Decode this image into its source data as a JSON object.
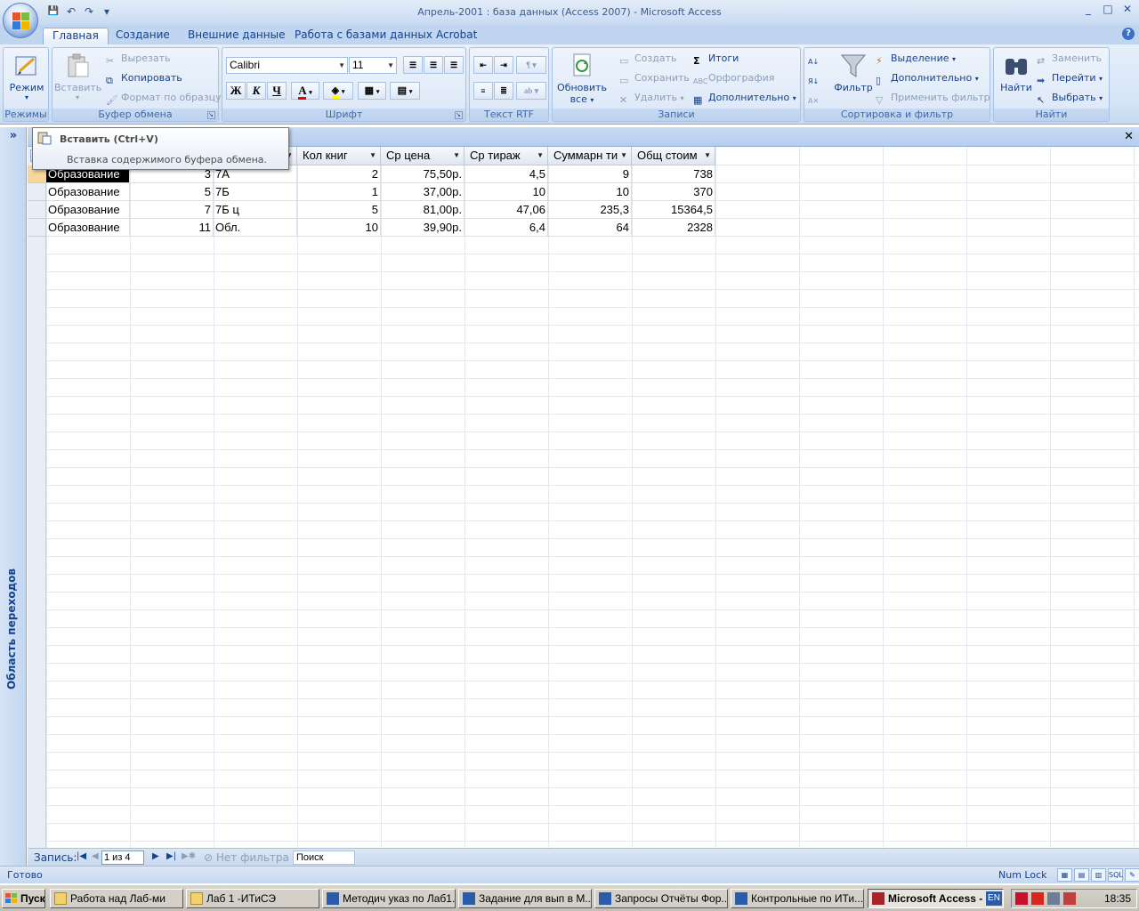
{
  "window": {
    "title": "Апрель-2001 : база данных (Access 2007) - Microsoft Access",
    "min": "_",
    "max": "□",
    "close": "✕"
  },
  "qat": {
    "save": "💾",
    "undo": "↶",
    "redo": "↷",
    "more": "▾"
  },
  "tabs": [
    "Главная",
    "Создание",
    "Внешние данные",
    "Работа с базами данных",
    "Acrobat"
  ],
  "help": "?",
  "ribbon": {
    "modes": {
      "view": "Режим",
      "group": "Режимы"
    },
    "clipboard": {
      "paste": "Вставить",
      "cut": "Вырезать",
      "copy": "Копировать",
      "format_painter": "Формат по образцу",
      "group": "Буфер обмена"
    },
    "font": {
      "name": "Calibri",
      "size": "11",
      "bold": "Ж",
      "italic": "К",
      "underline": "Ч",
      "group": "Шрифт"
    },
    "rtf": {
      "group": "Текст RTF"
    },
    "records": {
      "refresh": "Обновить",
      "refresh2": "все",
      "new": "Создать",
      "save": "Сохранить",
      "delete": "Удалить",
      "totals": "Итоги",
      "spelling": "Орфография",
      "more": "Дополнительно",
      "group": "Записи"
    },
    "sort": {
      "filter": "Фильтр",
      "selection": "Выделение",
      "advanced": "Дополнительно",
      "toggle": "Применить фильтр",
      "group": "Сортировка и фильтр"
    },
    "find": {
      "find": "Найти",
      "replace": "Заменить",
      "goto": "Перейти",
      "select": "Выбрать",
      "group": "Найти"
    }
  },
  "nav_pane": {
    "toggle": "»",
    "label": "Область переходов"
  },
  "doc": {
    "close": "✕"
  },
  "tooltip": {
    "title": "Вставить (Ctrl+V)",
    "description": "Вставка содержимого буфера обмена."
  },
  "table": {
    "columns": [
      "",
      "",
      "",
      "Кол книг",
      "Ср цена",
      "Ср тираж",
      "Суммарн ти",
      "Общ стоим"
    ],
    "rows": [
      [
        "Образование",
        "3",
        "7А",
        "2",
        "75,50р.",
        "4,5",
        "9",
        "738"
      ],
      [
        "Образование",
        "5",
        "7Б",
        "1",
        "37,00р.",
        "10",
        "10",
        "370"
      ],
      [
        "Образование",
        "7",
        "7Б ц",
        "5",
        "81,00р.",
        "47,06",
        "235,3",
        "15364,5"
      ],
      [
        "Образование",
        "11",
        "Обл.",
        "10",
        "39,90р.",
        "6,4",
        "64",
        "2328"
      ]
    ]
  },
  "record_nav": {
    "label": "Запись:",
    "position": "1 из 4",
    "no_filter": "Нет фильтра",
    "search": "Поиск"
  },
  "status": {
    "ready": "Готово",
    "numlock": "Num Lock"
  },
  "taskbar": {
    "start": "Пуск",
    "items": [
      "Работа над Лаб-ми",
      "Лаб 1 -ИТиСЭ",
      "Методич указ по Лаб1...",
      "Задание для вып в М...",
      "Запросы Отчёты Фор...",
      "Контрольные по ИТи...",
      "Microsoft Access - ..."
    ],
    "lang": "EN",
    "time": "18:35"
  },
  "colors": {
    "accent": "#15428b",
    "ribbon_bg": "#d6e5f7",
    "selected_cell": "#000000"
  }
}
